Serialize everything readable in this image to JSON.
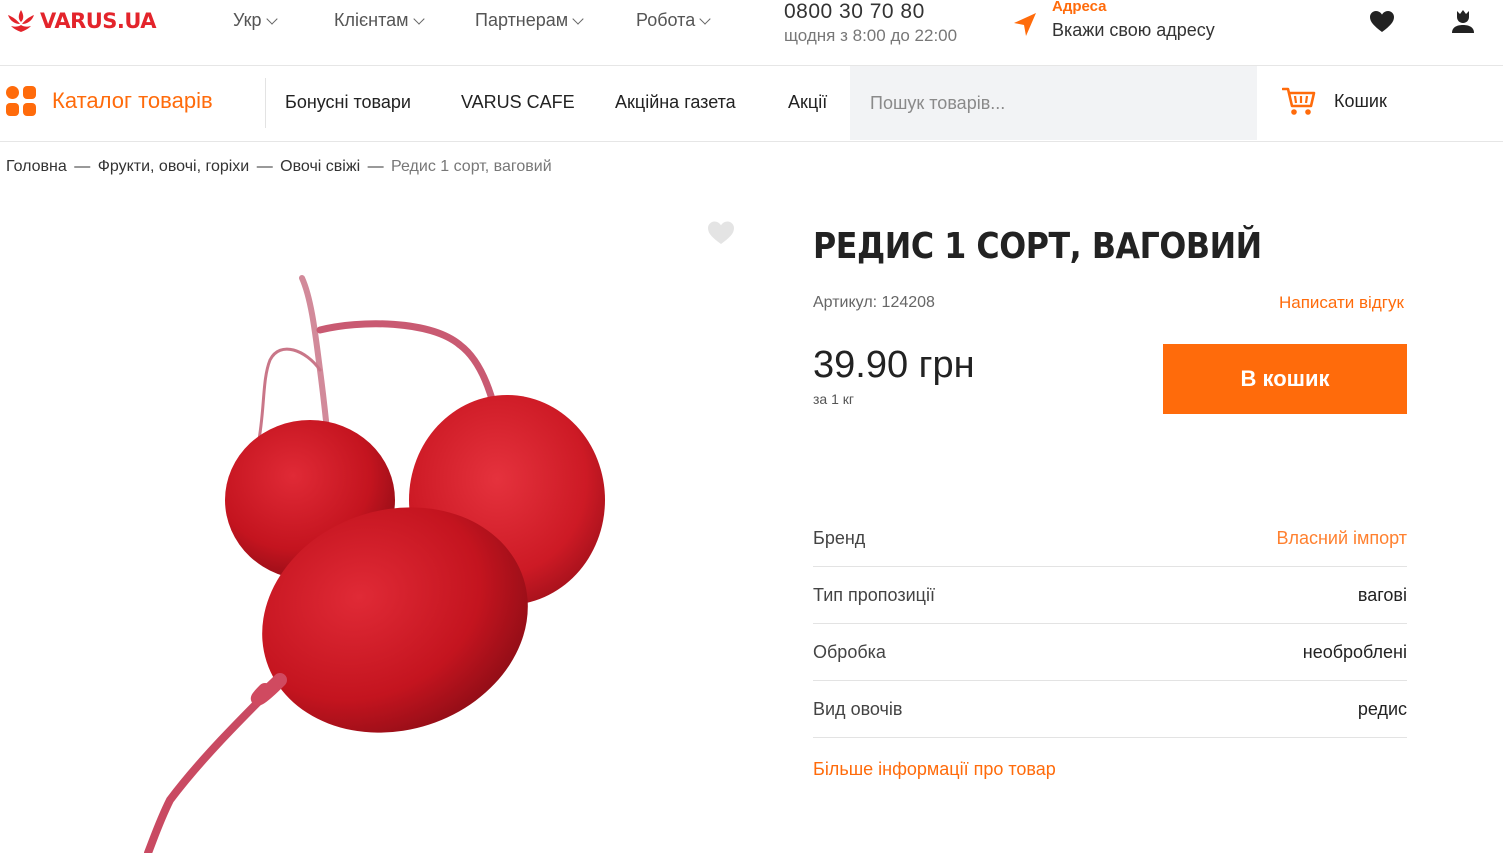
{
  "brand": {
    "name": "VARUS.UA",
    "color": "#e3242b"
  },
  "accent": "#ff6b0b",
  "topnav": {
    "lang": "Укр",
    "clients": "Клієнтам",
    "partners": "Партнерам",
    "work": "Робота"
  },
  "contact": {
    "phone": "0800 30 70 80",
    "hours": "щодня з 8:00 до 22:00"
  },
  "address": {
    "title": "Адреса",
    "prompt": "Вкажи свою адресу"
  },
  "icons": {
    "favorites": "heart-icon",
    "account": "user-icon",
    "cart": "cart-icon",
    "location": "location-arrow-icon"
  },
  "navbar": {
    "catalog": "Каталог товарів",
    "items": [
      "Бонусні товари",
      "VARUS CAFE",
      "Акційна газета",
      "Акції"
    ],
    "search_placeholder": "Пошук товарів...",
    "cart_label": "Кошик"
  },
  "breadcrumb": {
    "items": [
      "Головна",
      "Фрукти, овочі, горіхи",
      "Овочі свіжі"
    ],
    "current": "Редис 1 сорт, ваговий",
    "separator": "—"
  },
  "product": {
    "title": "РЕДИС 1 СОРТ, ВАГОВИЙ",
    "sku": "Артикул: 124208",
    "review_link": "Написати відгук",
    "price": "39.90 грн",
    "unit": "за 1 кг",
    "buy_label": "В кошик",
    "specs": [
      {
        "name": "Бренд",
        "value": "Власний імпорт",
        "link": true
      },
      {
        "name": "Тип пропозиції",
        "value": "вагові",
        "link": false
      },
      {
        "name": "Обробка",
        "value": "необроблені",
        "link": false
      },
      {
        "name": "Вид овочів",
        "value": "редис",
        "link": false
      }
    ],
    "more_link": "Більше інформації про товар"
  }
}
